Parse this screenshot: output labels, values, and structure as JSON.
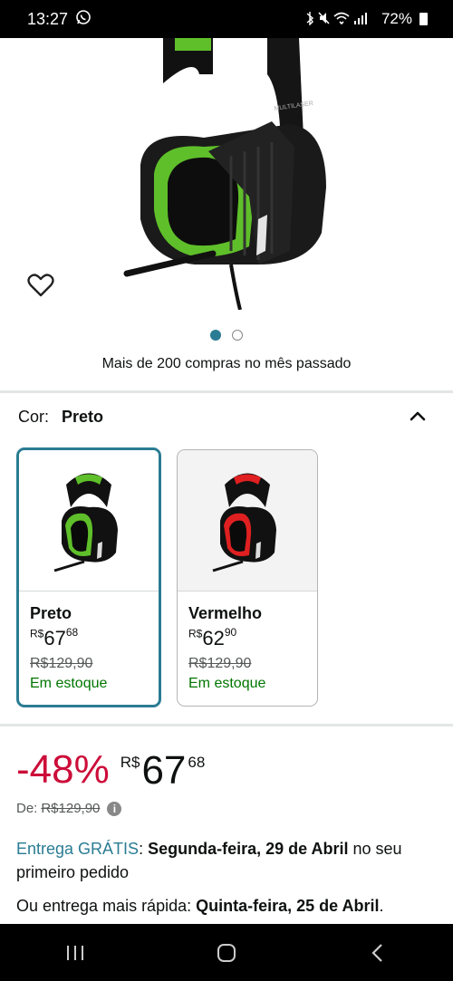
{
  "status_bar": {
    "time": "13:27",
    "battery": "72%"
  },
  "hero": {
    "bought_text": "Mais de 200 compras no mês passado"
  },
  "color_selector": {
    "label": "Cor:",
    "selected": "Preto"
  },
  "swatches": [
    {
      "name": "Preto",
      "currency": "R$",
      "price_int": "67",
      "price_frac": "68",
      "old_price": "R$129,90",
      "stock": "Em estoque"
    },
    {
      "name": "Vermelho",
      "currency": "R$",
      "price_int": "62",
      "price_frac": "90",
      "old_price": "R$129,90",
      "stock": "Em estoque"
    }
  ],
  "price": {
    "discount": "-48%",
    "currency": "R$",
    "int": "67",
    "frac": "68",
    "list_label": "De:",
    "list_price": "R$129,90"
  },
  "delivery": {
    "free_label": "Entrega GRÁTIS",
    "colon": ":",
    "date": "Segunda-feira, 29 de Abril",
    "suffix": "no seu primeiro pedido",
    "fast_prefix": "Ou entrega mais rápida:",
    "fast_date": "Quinta-feira, 25 de Abril",
    "fast_suffix": "."
  },
  "colors": {
    "accent": "#2a7c93",
    "discount": "#cc0c39",
    "stock": "#007600"
  }
}
